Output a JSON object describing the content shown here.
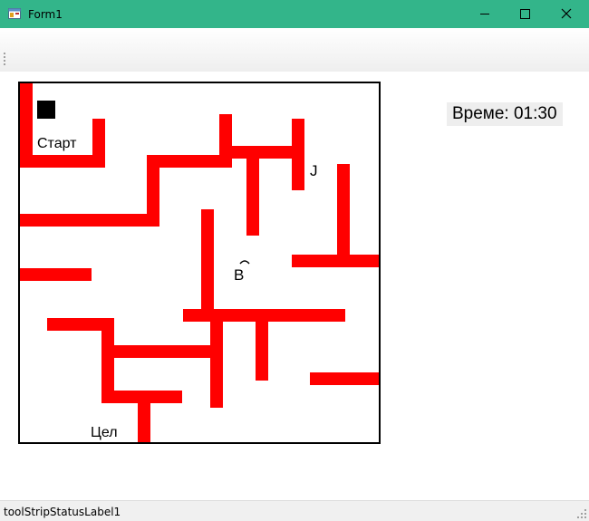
{
  "window": {
    "title": "Form1",
    "accent_color": "#33b58a",
    "icons": [
      "app-icon",
      "minimize-icon",
      "maximize-icon",
      "close-icon"
    ]
  },
  "game": {
    "wall_color": "#ff0000",
    "player_color": "#000000",
    "start_label": "Старт",
    "goal_label": "Цел",
    "marker_j": "J",
    "marker_b": "B",
    "timer_text": "Време: 01:30"
  },
  "statusbar": {
    "label": "toolStripStatusLabel1"
  }
}
